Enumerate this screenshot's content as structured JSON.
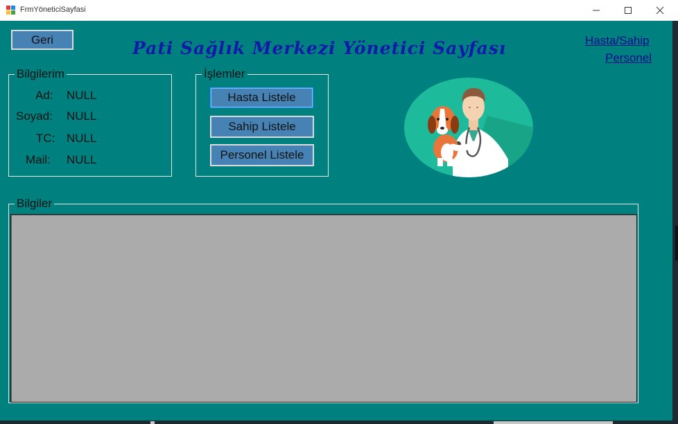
{
  "window": {
    "title": "FrmYöneticiSayfasi"
  },
  "nav": {
    "back_label": "Geri"
  },
  "header": {
    "title": "Pati Sağlık Merkezi Yönetici Sayfası"
  },
  "links": {
    "patient_owner": "Hasta/Sahip",
    "staff": "Personel"
  },
  "profile": {
    "legend": "Bilgilerim",
    "rows": [
      {
        "label": "Ad:",
        "value": "NULL"
      },
      {
        "label": "Soyad:",
        "value": "NULL"
      },
      {
        "label": "TC:",
        "value": "NULL"
      },
      {
        "label": "Mail:",
        "value": "NULL"
      }
    ]
  },
  "actions": {
    "legend": "İşlemler",
    "list_patients": "Hasta Listele",
    "list_owners": "Sahip Listele",
    "list_staff": "Personel Listele"
  },
  "info": {
    "legend": "Bilgiler"
  },
  "icons": {
    "app": "app-icon",
    "illustration": "vet-with-dog-illustration"
  },
  "colors": {
    "background": "#008080",
    "button": "#4682b4",
    "heading": "#121aa8",
    "link": "#0b0b8a",
    "grid": "#ababab"
  }
}
